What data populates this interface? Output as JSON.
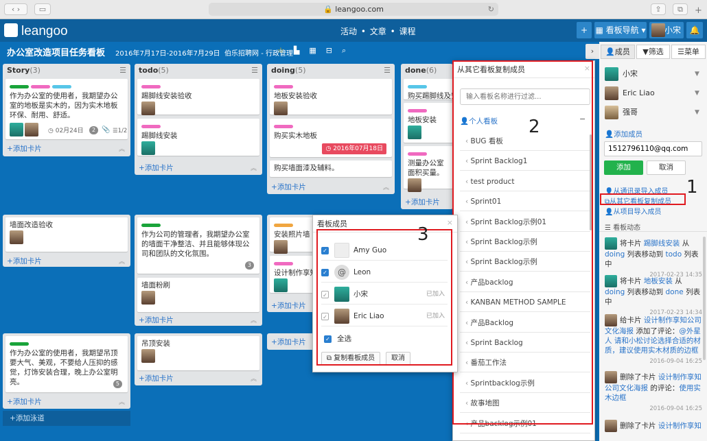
{
  "browser": {
    "url": "leangoo.com"
  },
  "app": {
    "logo": "leangoo",
    "nav": [
      "活动",
      "文章",
      "课程"
    ],
    "board_nav": "看板导航",
    "user": "小宋"
  },
  "board": {
    "title": "办公室改造项目任务看板",
    "dates": "2016年7月17日-2016年7月29日",
    "owner": "伯乐招聘网 - 行政管理"
  },
  "lanes": [
    {
      "columns": [
        {
          "name": "Story",
          "count": "(3)",
          "cards": [
            {
              "text": "作为办公室的使用者，我期望办公室的地板是实木的，因为实木地板环保、耐用、舒适。",
              "due": "02月24日",
              "comments": "2",
              "checklist": "1/2"
            }
          ],
          "add": "添加卡片"
        },
        {
          "name": "todo",
          "count": "(5)",
          "cards": [
            {
              "text": "踢脚线安装验收"
            },
            {
              "text": "踢脚线安装"
            }
          ],
          "add": "添加卡片"
        },
        {
          "name": "doing",
          "count": "(5)",
          "cards": [
            {
              "text": "地板安装验收"
            },
            {
              "text": "购买实木地板",
              "due": "2016年07月18日"
            },
            {
              "text": "购买墙面漆及辅料。"
            }
          ],
          "add": "添加卡片"
        },
        {
          "name": "done",
          "count": "(6)",
          "cards": [
            {
              "text": "购买踢脚线及安"
            },
            {
              "text": "地板安装"
            },
            {
              "text": "测量办公室面积买量。"
            }
          ],
          "add": "添加卡片"
        }
      ]
    },
    {
      "cards": [
        {
          "text": "墙面改造验收"
        },
        {
          "text": "作为公司的管理者，我期望办公室的墙面干净整洁、并且能够体现公司和团队的文化氛围。",
          "badge": "3"
        },
        {
          "text": "墙面粉刷"
        },
        {
          "text": "安装照片墙"
        },
        {
          "text": "设计制作享知"
        }
      ],
      "add": "添加卡片"
    },
    {
      "cards": [
        {
          "text": "作为办公室的使用者，我期望吊顶要大气、美观，不要给人压抑的感觉，灯饰安装合理，晚上办公室明亮。",
          "badge": "5"
        },
        {
          "text": "吊顶安装"
        }
      ],
      "add": "添加卡片"
    }
  ],
  "add_lane": "添加泳道",
  "copy_dialog": {
    "title": "从其它看板复制成员",
    "filter_placeholder": "输入看板名称进行过滤...",
    "group": "个人看板",
    "boards": [
      "BUG 看板",
      "Sprint Backlog1",
      "test product",
      "Sprint01",
      "Sprint Backlog示例01",
      "Sprint Backlog示例",
      "Sprint Backlog示例",
      "产品backlog",
      "KANBAN METHOD SAMPLE",
      "产品Backlog",
      "Sprint Backlog",
      "番茄工作法",
      "Sprintbacklog示例",
      "故事地图",
      "产品backlog示例01"
    ]
  },
  "members_dialog": {
    "title": "看板成员",
    "members": [
      {
        "name": "Amy Guo",
        "status": ""
      },
      {
        "name": "Leon",
        "status": ""
      },
      {
        "name": "小宋",
        "status": "已加入"
      },
      {
        "name": "Eric Liao",
        "status": "已加入"
      }
    ],
    "select_all": "全选",
    "copy_btn": "复制看板成员",
    "cancel_btn": "取消"
  },
  "panel": {
    "tabs": [
      "成员",
      "筛选",
      "菜单"
    ],
    "members": [
      "小宋",
      "Eric Liao",
      "强哥"
    ],
    "add_member": "添加成员",
    "email": "1512796110@qq.com",
    "add_btn": "添加",
    "cancel_btn": "取消",
    "import_contacts": "从通讯录导入成员",
    "copy_from_board": "从其它看板复制成员",
    "import_project": "从项目导入成员",
    "activity_title": "看板动态",
    "activities": [
      {
        "a": "将卡片",
        "b": "踢脚线安装",
        "c": "从",
        "d": "doing",
        "e": "列表移动到",
        "f": "todo",
        "g": "列表中",
        "time": "2017-02-23 14:35"
      },
      {
        "a": "将卡片",
        "b": "地板安装",
        "c": "从",
        "d": "doing",
        "e": "列表移动到",
        "f": "done",
        "g": "列表中",
        "time": "2017-02-23 14:34"
      },
      {
        "a": "给卡片",
        "b": "设计制作享知公司文化海报",
        "c": "添加了评论：",
        "d": "@外星人 请和小松讨论选择合适的材质，建议使用实木材质的边框",
        "time": "2016-09-04 16:25"
      },
      {
        "a": "删除了卡片",
        "b": "设计制作享知公司文化海报",
        "c": "的评论：",
        "d": "使用实木边框",
        "time": "2016-09-04 16:25"
      },
      {
        "a": "删除了卡片",
        "b": "设计制作享知"
      }
    ]
  },
  "annotations": [
    "1",
    "2",
    "3"
  ]
}
